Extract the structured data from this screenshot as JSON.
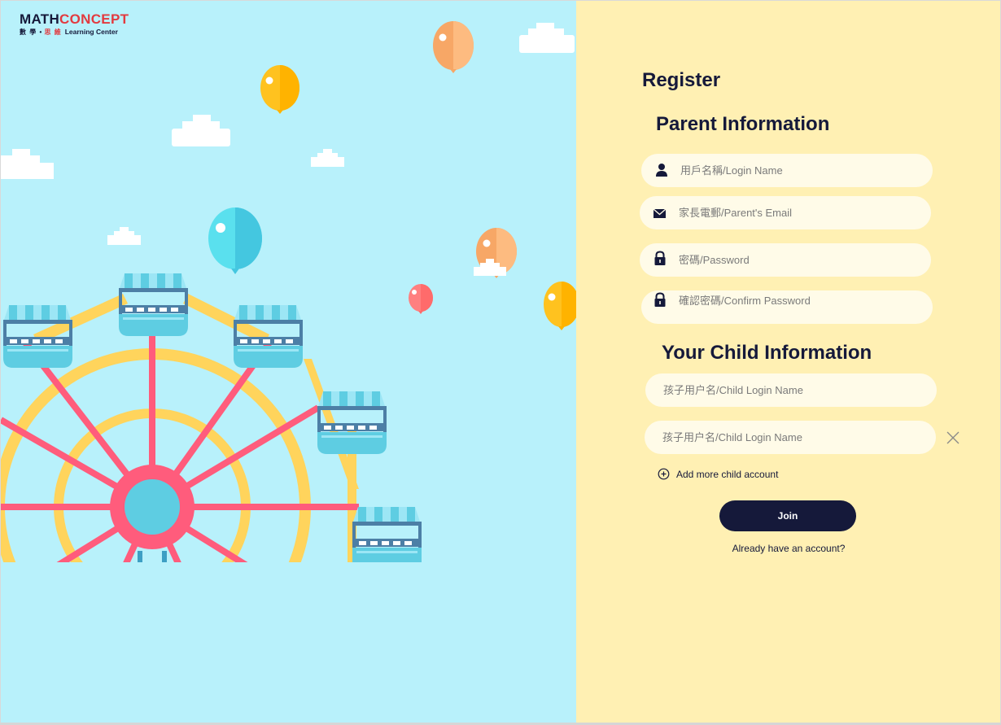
{
  "logo": {
    "math": "MATH",
    "concept": "CONCEPT",
    "sub_cn_1": "數 學 •",
    "sub_cn_2": "思 維",
    "sub_en": "Learning Center"
  },
  "form": {
    "title": "Register",
    "parent_section_title": "Parent Information",
    "parent_fields": {
      "login_name": {
        "placeholder": "用戶名稱/Login Name",
        "value": ""
      },
      "parent_email": {
        "placeholder": "家長電郵/Parent's Email",
        "value": ""
      },
      "password": {
        "placeholder": "密碼/Password",
        "value": ""
      },
      "confirm_password": {
        "placeholder": "確認密碼/Confirm Password",
        "value": ""
      }
    },
    "child_section_title": "Your Child Information",
    "child_fields": [
      {
        "placeholder": "孩子用户名/Child Login Name",
        "value": ""
      },
      {
        "placeholder": "孩子用户名/Child Login Name",
        "value": ""
      }
    ],
    "add_more_label": "Add more child account",
    "join_label": "Join",
    "already_label": "Already have an account?"
  },
  "colors": {
    "sky": "#b8f1fb",
    "panel": "#fff0b3",
    "field": "#fffbe8",
    "navy": "#15193a",
    "brand_red": "#e23a3f"
  },
  "icons": {
    "login_name": "user-icon",
    "email": "envelope-icon",
    "password": "lock-icon",
    "confirm_password": "lock-icon",
    "remove_child": "close-icon",
    "add_more": "plus-circle-icon"
  }
}
